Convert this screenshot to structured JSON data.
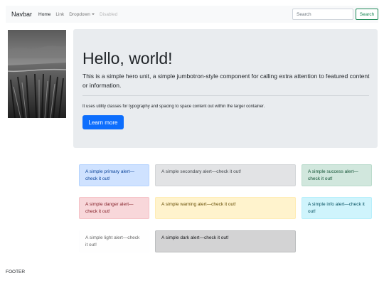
{
  "navbar": {
    "brand": "Navbar",
    "links": [
      "Home",
      "Link",
      "Dropdown",
      "Disabled"
    ],
    "search_placeholder": "Search",
    "search_button": "Search",
    "accent_color": "#198754"
  },
  "jumbotron": {
    "title": "Hello, world!",
    "lead": "This is a simple hero unit, a simple jumbotron-style component for calling extra attention to featured content or information.",
    "text": "It uses utility classes for typography and spacing to space content out within the larger container.",
    "button": "Learn more",
    "button_color": "#0d6efd"
  },
  "alerts": [
    {
      "variant": "primary",
      "text": "A simple primary alert—check it out!"
    },
    {
      "variant": "secondary",
      "text": "A simple secondary alert—check it out!"
    },
    {
      "variant": "success",
      "text": "A simple success alert—check it out!"
    },
    {
      "variant": "danger",
      "text": "A simple danger alert—check it out!"
    },
    {
      "variant": "warning",
      "text": "A simple warning alert—check it out!"
    },
    {
      "variant": "info",
      "text": "A simple info alert—check it out!"
    },
    {
      "variant": "light",
      "text": "A simple light alert—check it out!"
    },
    {
      "variant": "dark",
      "text": "A simple dark alert—check it out!"
    }
  ],
  "footer": "FOOTER"
}
